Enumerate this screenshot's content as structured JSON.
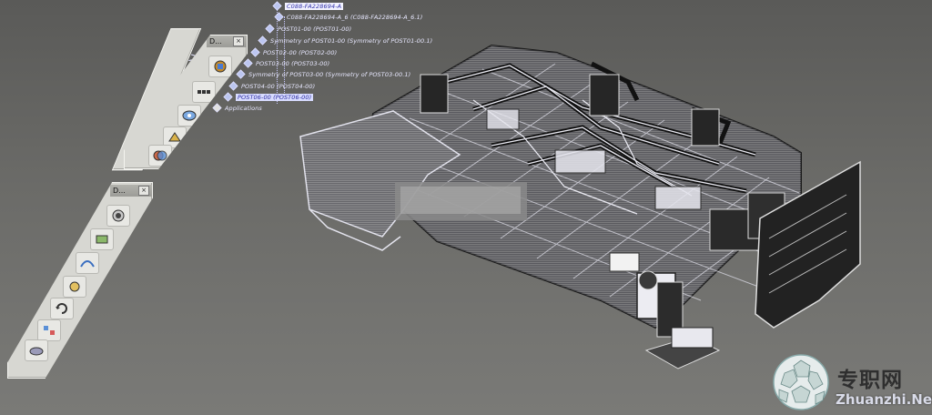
{
  "spec_tree": {
    "nodes": [
      {
        "label": "C088-FA228694-A"
      },
      {
        "label": "C088-FA228694-A_6 (C088-FA228694-A_6.1)"
      },
      {
        "label": "POST01-00 (POST01-00)"
      },
      {
        "label": "Symmetry of POST01-00 (Symmetry of POST01-00.1)"
      },
      {
        "label": "POST02-00 (POST02-00)"
      },
      {
        "label": "POST03-00 (POST03-00)"
      },
      {
        "label": "Symmetry of POST03-00 (Symmetry of POST03-00.1)"
      },
      {
        "label": "POST04-00 (POST04-00)"
      },
      {
        "label": "POST06-00 (POST06-00)"
      },
      {
        "label": "Applications"
      }
    ]
  },
  "toolbars": [
    {
      "title": "D...",
      "close": "×",
      "tools": [
        "analysis-icon",
        "cursor-tool-icon",
        "measure-icon",
        "section-icon",
        "clash-icon",
        "inspect-icon"
      ]
    },
    {
      "title": "D...",
      "close": "×",
      "tools": [
        "compare-icon",
        "simulation-icon",
        "path-icon",
        "track-icon",
        "rotate-icon",
        "sequence-icon",
        "scene-icon",
        "move-icon"
      ]
    }
  ],
  "watermark": {
    "chinese": "专职网",
    "english": "Zhuanzhi.Net"
  },
  "colors": {
    "background": "#6b6b68",
    "wire": "#e6e6ee",
    "wire_dark": "#1e1e1e",
    "tree_text": "#e8e8ff",
    "highlight": "#d8dcff"
  }
}
